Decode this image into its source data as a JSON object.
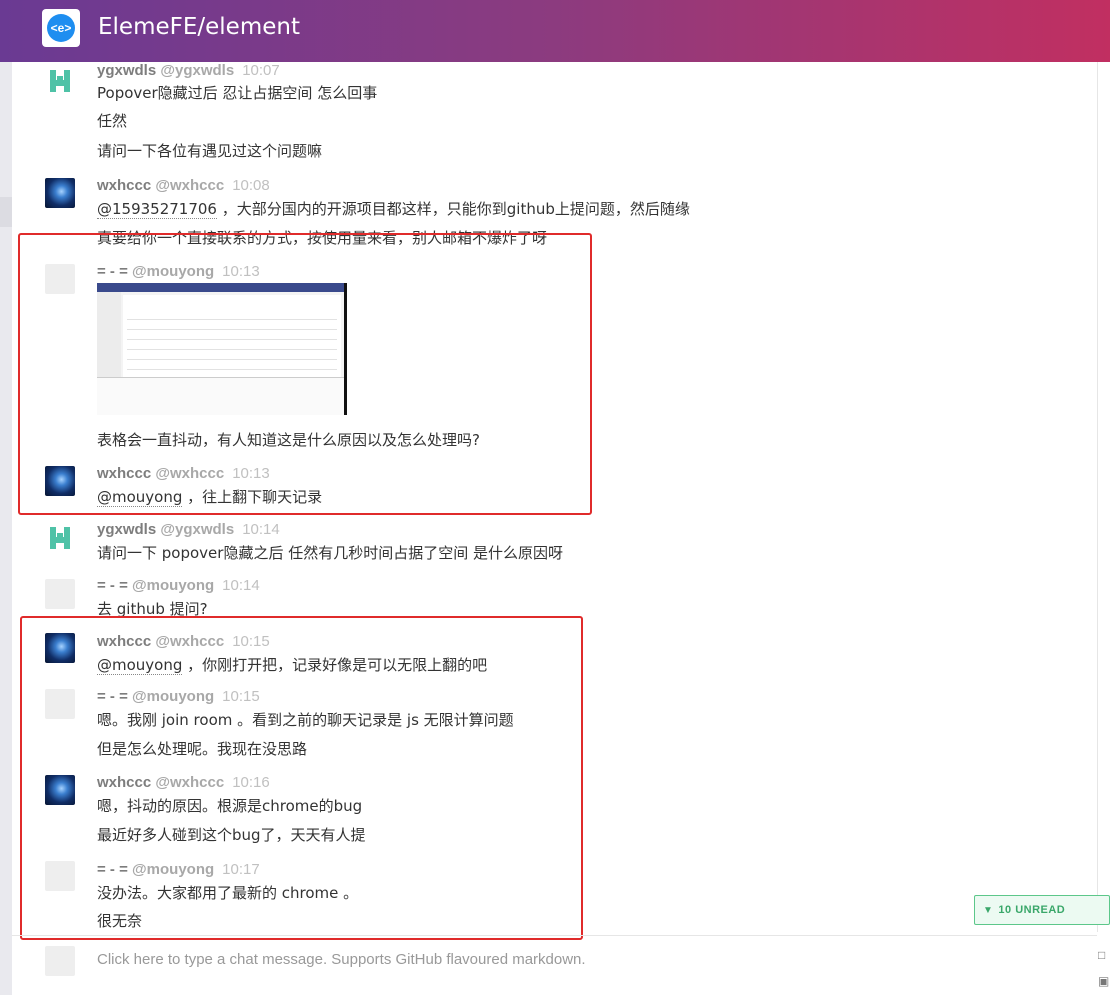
{
  "header": {
    "title": "ElemeFE/element",
    "logo_text": "<e>"
  },
  "messages": [
    {
      "name": "ygxwdls",
      "handle": "@ygxwdls",
      "time": "10:07",
      "lines": [
        "Popover隐藏过后 忍让占据空间 怎么回事",
        "任然",
        "请问一下各位有遇见过这个问题嘛"
      ]
    },
    {
      "name": "wxhccc",
      "handle": "@wxhccc",
      "time": "10:08",
      "mention": "@15935271706",
      "lines": [
        "，大部分国内的开源项目都这样，只能你到github上提问题，然后随缘",
        "真要给你一个直接联系的方式，按使用量来看，别人邮箱不爆炸了呀"
      ]
    },
    {
      "name": "= - =",
      "handle": "@mouyong",
      "time": "10:13",
      "lines": [
        "表格会一直抖动，有人知道这是什么原因以及怎么处理吗?"
      ]
    },
    {
      "name": "wxhccc",
      "handle": "@wxhccc",
      "time": "10:13",
      "mention": "@mouyong",
      "lines": [
        "，往上翻下聊天记录"
      ]
    },
    {
      "name": "ygxwdls",
      "handle": "@ygxwdls",
      "time": "10:14",
      "lines": [
        "请问一下 popover隐藏之后 任然有几秒时间占据了空间 是什么原因呀"
      ]
    },
    {
      "name": "= - =",
      "handle": "@mouyong",
      "time": "10:14",
      "lines": [
        "去 github 提问?"
      ]
    },
    {
      "name": "wxhccc",
      "handle": "@wxhccc",
      "time": "10:15",
      "mention": "@mouyong",
      "lines": [
        "，你刚打开把，记录好像是可以无限上翻的吧"
      ]
    },
    {
      "name": "= - =",
      "handle": "@mouyong",
      "time": "10:15",
      "lines": [
        "嗯。我刚 join room 。看到之前的聊天记录是 js 无限计算问题",
        "但是怎么处理呢。我现在没思路"
      ]
    },
    {
      "name": "wxhccc",
      "handle": "@wxhccc",
      "time": "10:16",
      "lines": [
        "嗯，抖动的原因。根源是chrome的bug",
        "最近好多人碰到这个bug了，天天有人提"
      ]
    },
    {
      "name": "= - =",
      "handle": "@mouyong",
      "time": "10:17",
      "lines": [
        "没办法。大家都用了最新的 chrome 。",
        "很无奈"
      ]
    }
  ],
  "unread": {
    "label": "10 UNREAD"
  },
  "composer": {
    "placeholder": "Click here to type a chat message. Supports GitHub flavoured markdown."
  },
  "colors": {
    "header_start": "#6a3a93",
    "header_end": "#c12f61",
    "highlight_box": "#e02b2b",
    "unread_green": "#3aa76a"
  }
}
